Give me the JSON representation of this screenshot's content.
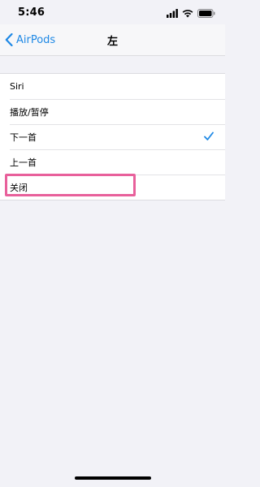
{
  "status_bar": {
    "time": "5:46",
    "signal_icon": "signal-bars-icon",
    "wifi_icon": "wifi-icon",
    "battery_icon": "battery-icon"
  },
  "nav": {
    "back_label": "AirPods",
    "back_icon": "chevron-left-icon",
    "title": "左"
  },
  "list": {
    "items": [
      {
        "label": "Siri",
        "selected": false
      },
      {
        "label": "播放/暂停",
        "selected": false
      },
      {
        "label": "下一首",
        "selected": true
      },
      {
        "label": "上一首",
        "selected": false
      },
      {
        "label": "关闭",
        "selected": false
      }
    ]
  },
  "colors": {
    "accent": "#1e88e5",
    "highlight": "#e8609b",
    "background": "#f2f2f7"
  }
}
